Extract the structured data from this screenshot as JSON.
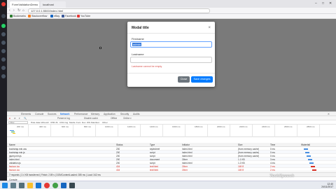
{
  "browser": {
    "tabs": [
      {
        "label": "FormValidationDemo"
      },
      {
        "label": "localhost"
      }
    ],
    "url": "127.0.0.1:5500/index.html",
    "bookmarks": [
      {
        "label": "Bookmarks",
        "color": "#2e7d32"
      },
      {
        "label": "Stackoverflow",
        "color": "#f48024"
      },
      {
        "label": "eBay",
        "color": "#1565c0"
      },
      {
        "label": "Facebook",
        "color": "#3b5998"
      },
      {
        "label": "YouTube",
        "color": "#e53935"
      }
    ],
    "window_controls": {
      "minimize": "–",
      "maximize": "□",
      "close": "✕"
    }
  },
  "modal": {
    "title": "Modal title",
    "close_glyph": "×",
    "first_name_label": "Firstname",
    "first_name_value": "admin",
    "last_name_label": "Lastname",
    "last_name_value": "",
    "error_text": "Lastname cannot be empty",
    "close_button": "Close",
    "save_button": "Save changes"
  },
  "devtools": {
    "tabs": [
      "Elements",
      "Console",
      "Sources",
      "Network",
      "Performance",
      "Memory",
      "Application",
      "Security",
      "Audits"
    ],
    "active_tab": "Network",
    "toolbar": [
      "●",
      "⊘",
      "▾",
      "🔍",
      "Preserve log",
      "Disable cache",
      "Offline",
      "Online ▾"
    ],
    "filter_placeholder": "Filter",
    "filter_types": [
      "Hide data URLs",
      "All",
      "XHR",
      "JS",
      "CSS",
      "Img",
      "Media",
      "Font",
      "Doc",
      "WS",
      "Manifest",
      "Other"
    ],
    "timeline_ticks": [
      "200 ms",
      "400 ms",
      "600 ms",
      "800 ms",
      "1000 ms",
      "1200 ms",
      "1400 ms",
      "1600 ms",
      "1800 ms",
      "2000 ms",
      "2200 ms",
      "2400 ms",
      "2600 ms",
      "2800 ms"
    ],
    "columns": [
      "Name",
      "Status",
      "Type",
      "Initiator",
      "Size",
      "Time",
      "Waterfall"
    ],
    "rows": [
      {
        "name": "bootstrap.min.css",
        "status": "200",
        "type": "stylesheet",
        "initiator": "index.html",
        "size": "(from memory cache)",
        "time": "0 ms"
      },
      {
        "name": "bootstrap.min.js",
        "status": "200",
        "type": "script",
        "initiator": "index.html",
        "size": "(from memory cache)",
        "time": "0 ms"
      },
      {
        "name": "jquery.min.js",
        "status": "200",
        "type": "script",
        "initiator": "index.html",
        "size": "(from memory cache)",
        "time": "0 ms"
      },
      {
        "name": "index.html",
        "status": "200",
        "type": "document",
        "initiator": "Other",
        "size": "1.1 KB",
        "time": "3 ms"
      },
      {
        "name": "validation.js",
        "status": "200",
        "type": "script",
        "initiator": "index.html",
        "size": "1.2 KB",
        "time": "4 ms"
      },
      {
        "name": "favicon.ico",
        "status": "404",
        "type": "text/html",
        "initiator": "Other",
        "size": "169 B",
        "time": "2 ms",
        "error": true
      },
      {
        "name": "favicon.ico",
        "status": "404",
        "type": "text/html",
        "initiator": "Other",
        "size": "169 B",
        "time": "2 ms",
        "error": true
      }
    ],
    "status_bar": "7 requests  |  2.4 KB transferred  |  Finish: 2.89 s  |  DOMContentLoaded: 285 ms  |  Load: 342 ms",
    "console_label": "Console"
  },
  "taskbar": {
    "icons": [
      {
        "name": "windows-start-icon",
        "color": "#1e88e5"
      },
      {
        "name": "search-icon",
        "color": "#607d8b"
      },
      {
        "name": "task-view-icon",
        "color": "#546e7a"
      },
      {
        "name": "file-explorer-icon",
        "color": "#fbc02d"
      },
      {
        "name": "store-icon",
        "color": "#1976d2"
      },
      {
        "name": "opera-icon",
        "color": "#e53935"
      },
      {
        "name": "chrome-icon",
        "color": "#43a047"
      },
      {
        "name": "vscode-icon",
        "color": "#1565c0"
      },
      {
        "name": "terminal-icon",
        "color": "#37474f"
      }
    ],
    "time": "12:40",
    "date": "24/11/2017"
  },
  "watermark": "TechSpeech"
}
